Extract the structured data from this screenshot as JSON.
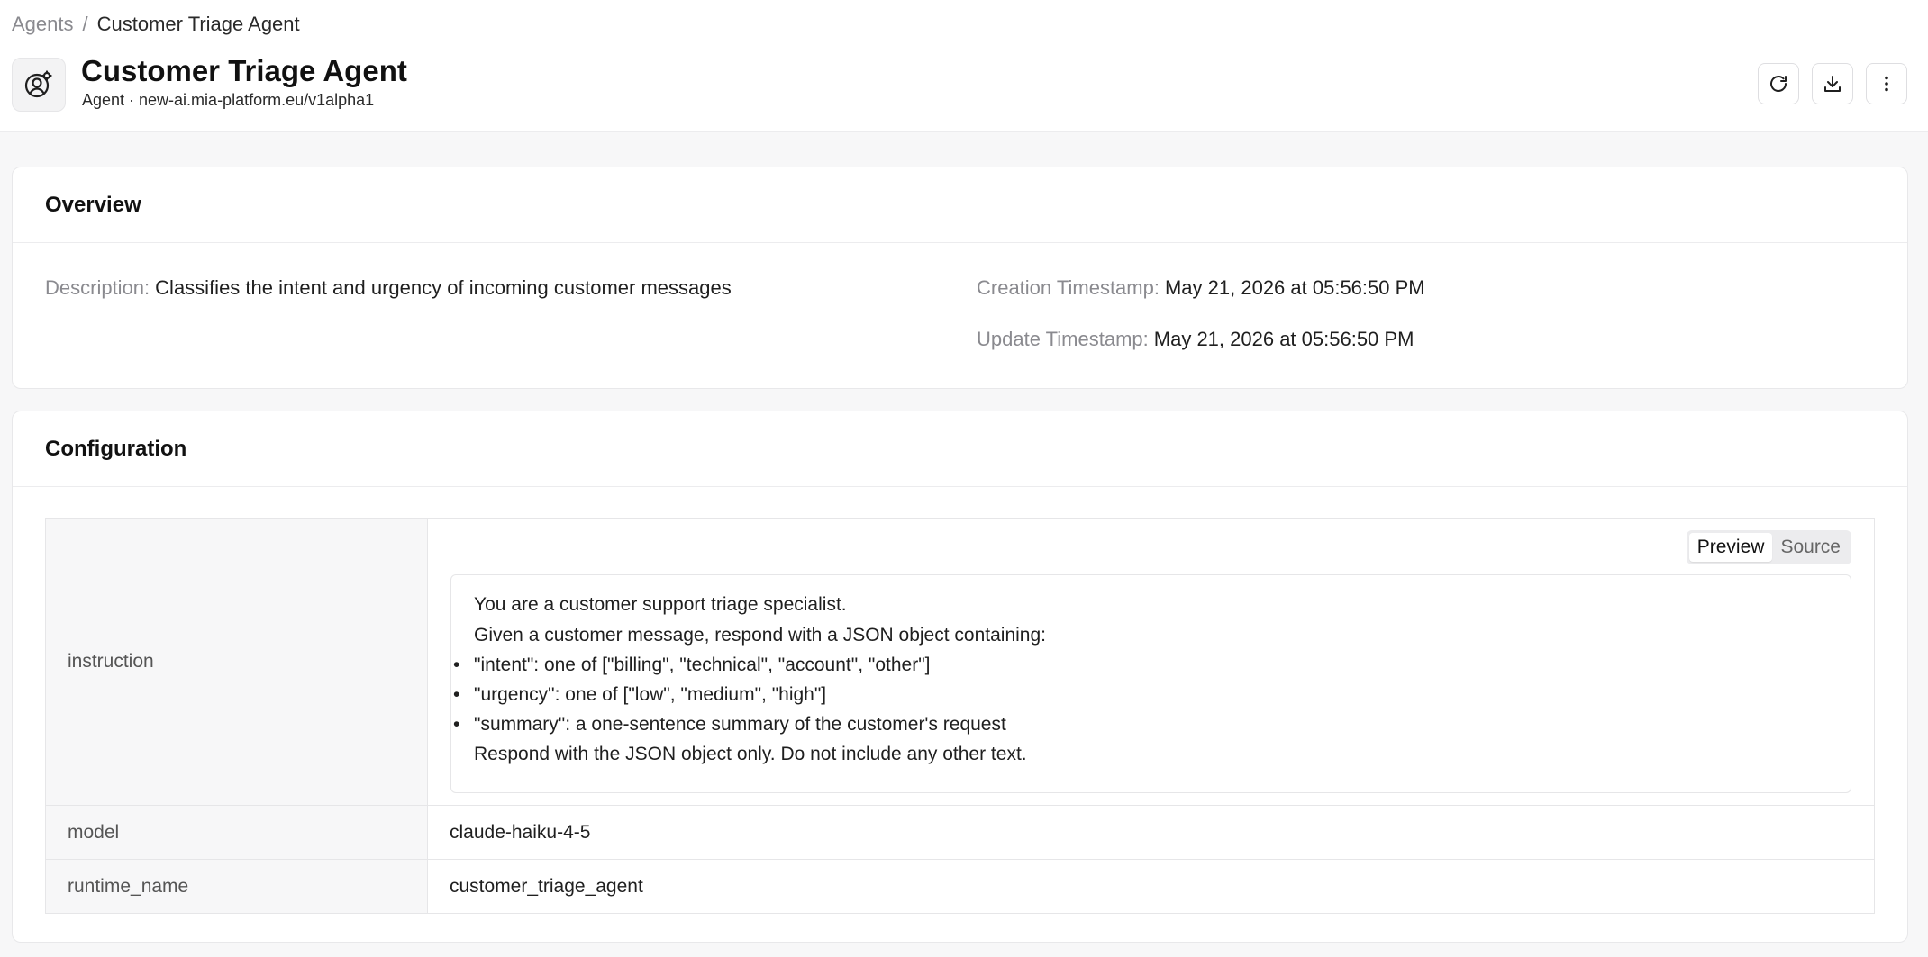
{
  "breadcrumb": {
    "parent": "Agents",
    "separator": "/",
    "current": "Customer Triage Agent"
  },
  "header": {
    "title": "Customer Triage Agent",
    "subtitle": "Agent · new-ai.mia-platform.eu/v1alpha1",
    "icon": "agent-icon",
    "actions": [
      "refresh-icon",
      "download-icon",
      "more-vertical-icon"
    ]
  },
  "overview": {
    "title": "Overview",
    "description_label": "Description",
    "description_value": "Classifies the intent and urgency of incoming customer messages",
    "creation_label": "Creation Timestamp",
    "creation_value": "May 21, 2026 at 05:56:50 PM",
    "update_label": "Update Timestamp",
    "update_value": "May 21, 2026 at 05:56:50 PM",
    "colon": ":"
  },
  "configuration": {
    "title": "Configuration",
    "view_toggle": {
      "preview": "Preview",
      "source": "Source",
      "selected": "Preview"
    },
    "instruction_key": "instruction",
    "instruction_lines": [
      "You are a customer support triage specialist.",
      "Given a customer message, respond with a JSON object containing:",
      "\"intent\": one of [\"billing\", \"technical\", \"account\", \"other\"]",
      "\"urgency\": one of [\"low\", \"medium\", \"high\"]",
      "\"summary\": a one-sentence summary of the customer's request",
      "Respond with the JSON object only. Do not include any other text."
    ],
    "model_key": "model",
    "model_value": "claude-haiku-4-5",
    "runtime_key": "runtime_name",
    "runtime_value": "customer_triage_agent"
  }
}
